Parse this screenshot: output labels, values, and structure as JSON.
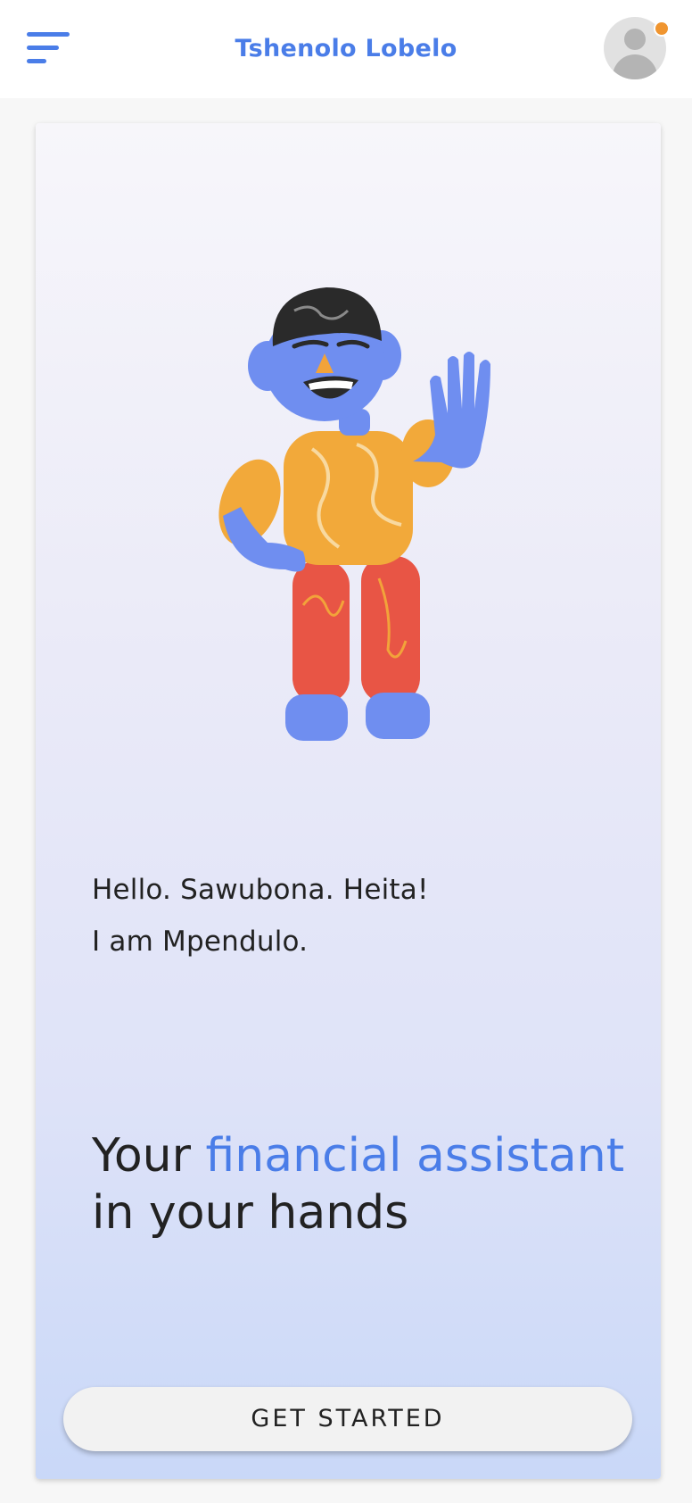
{
  "header": {
    "menu_icon": "menu-icon",
    "title": "Tshenolo Lobelo",
    "avatar_icon": "user-avatar-icon",
    "notification_color": "#f09530"
  },
  "card": {
    "illustration": "waving-mascot-illustration",
    "greeting_line1": "Hello. Sawubona. Heita!",
    "greeting_line2": "I am Mpendulo.",
    "tagline_part1": "Your ",
    "tagline_accent": "financial assistant",
    "tagline_part2": " in your hands",
    "cta_label": "GET STARTED"
  },
  "colors": {
    "accent": "#4a7de8",
    "text": "#222222",
    "notification": "#f09530"
  }
}
